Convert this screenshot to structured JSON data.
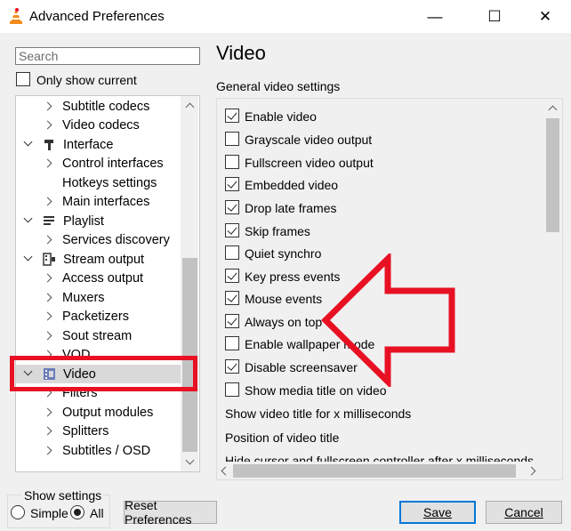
{
  "window": {
    "title": "Advanced Preferences",
    "minimize_glyph": "—",
    "maximize_glyph": "☐",
    "close_glyph": "✕"
  },
  "left": {
    "search_placeholder": "Search",
    "only_show_current": "Only show current",
    "tree": [
      {
        "label": "Subtitle codecs"
      },
      {
        "label": "Video codecs"
      },
      {
        "label": "Interface"
      },
      {
        "label": "Control interfaces"
      },
      {
        "label": "Hotkeys settings"
      },
      {
        "label": "Main interfaces"
      },
      {
        "label": "Playlist"
      },
      {
        "label": "Services discovery"
      },
      {
        "label": "Stream output"
      },
      {
        "label": "Access output"
      },
      {
        "label": "Muxers"
      },
      {
        "label": "Packetizers"
      },
      {
        "label": "Sout stream"
      },
      {
        "label": "VOD"
      },
      {
        "label": "Video"
      },
      {
        "label": "Filters"
      },
      {
        "label": "Output modules"
      },
      {
        "label": "Splitters"
      },
      {
        "label": "Subtitles / OSD"
      }
    ]
  },
  "right": {
    "heading": "Video",
    "subheading": "General video settings",
    "options": [
      {
        "label": "Enable video",
        "checked": true
      },
      {
        "label": "Grayscale video output",
        "checked": false
      },
      {
        "label": "Fullscreen video output",
        "checked": false
      },
      {
        "label": "Embedded video",
        "checked": true
      },
      {
        "label": "Drop late frames",
        "checked": true
      },
      {
        "label": "Skip frames",
        "checked": true
      },
      {
        "label": "Quiet synchro",
        "checked": false
      },
      {
        "label": "Key press events",
        "checked": true
      },
      {
        "label": "Mouse events",
        "checked": true
      },
      {
        "label": "Always on top",
        "checked": true
      },
      {
        "label": "Enable wallpaper mode",
        "checked": false
      },
      {
        "label": "Disable screensaver",
        "checked": true
      },
      {
        "label": "Show media title on video",
        "checked": false
      }
    ],
    "text_rows": [
      "Show video title for x milliseconds",
      "Position of video title",
      "Hide cursor and fullscreen controller after x milliseconds"
    ]
  },
  "bottom": {
    "show_settings": "Show settings",
    "simple": "Simple",
    "all": "All",
    "selected": "All",
    "reset": "Reset Preferences",
    "save": "Save",
    "cancel": "Cancel"
  },
  "colors": {
    "highlight": "#e81123",
    "selected_row": "#d9d9d9"
  }
}
